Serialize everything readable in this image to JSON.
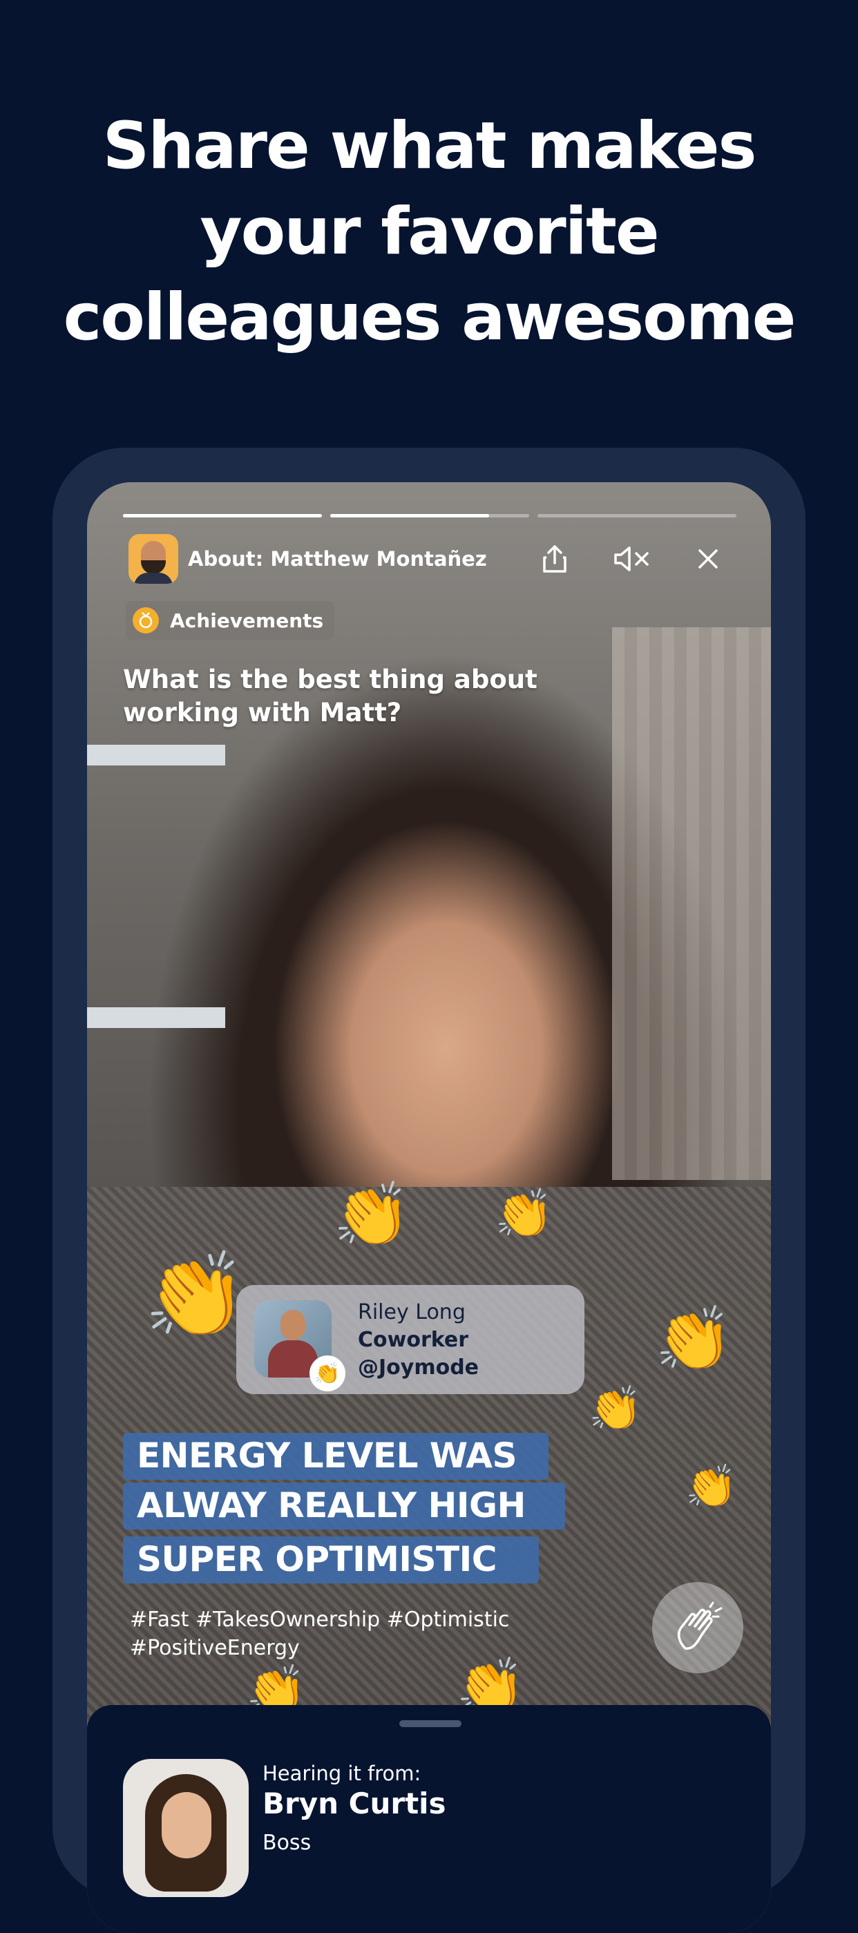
{
  "headline": {
    "line1": "Share what makes",
    "line2": "your favorite",
    "line3": "colleagues awesome"
  },
  "story": {
    "progress": [
      1.0,
      0.8,
      0.0
    ],
    "about_label": "About: Matthew Montañez",
    "icons": {
      "share": "share-icon",
      "mute": "mute-icon",
      "close": "close-icon"
    },
    "category": "Achievements",
    "question": "What is the best thing about working with Matt?",
    "author": {
      "name": "Riley Long",
      "role": "Coworker",
      "company": "@Joymode"
    },
    "captions": [
      "ENERGY LEVEL WAS",
      "ALWAY REALLY HIGH",
      "SUPER OPTIMISTIC"
    ],
    "hashtags": "#Fast #TakesOwnership #Optimistic #PositiveEnergy"
  },
  "sheet": {
    "label": "Hearing it from:",
    "name": "Bryn Curtis",
    "role": "Boss"
  },
  "colors": {
    "background": "#061430",
    "frame": "#1b2b48",
    "caption_highlight": "#3f6aa7",
    "medal": "#f4b02c"
  }
}
